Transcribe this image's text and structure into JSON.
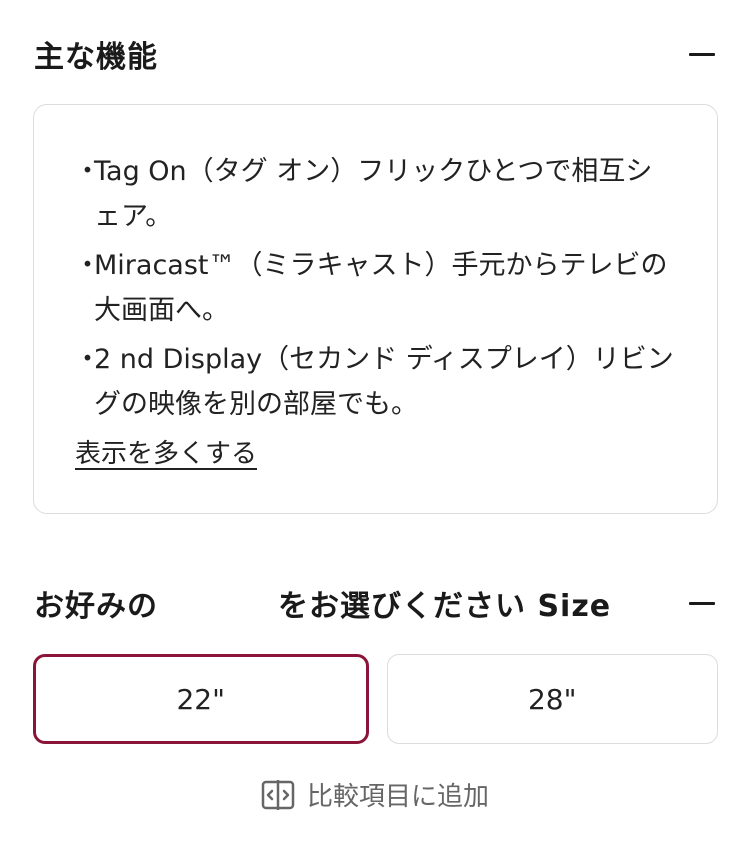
{
  "features": {
    "title": "主な機能",
    "items": [
      "Tag On（タグ オン）フリックひとつで相互シェア。",
      "Miracast™（ミラキャスト）手元からテレビの大画面へ。",
      "2 nd Display（セカンド ディスプレイ）リビングの映像を別の部屋でも。"
    ],
    "show_more_label": "表示を多くする"
  },
  "size": {
    "title_prefix": "お好みの",
    "title_suffix": "をお選びください Size",
    "options": [
      {
        "label": "22\"",
        "selected": true
      },
      {
        "label": "28\"",
        "selected": false
      }
    ]
  },
  "compare": {
    "label": "比較項目に追加",
    "icon": "compare-icon"
  },
  "colors": {
    "accent": "#8a1538",
    "border": "#dcdcdc",
    "muted_text": "#666666"
  }
}
